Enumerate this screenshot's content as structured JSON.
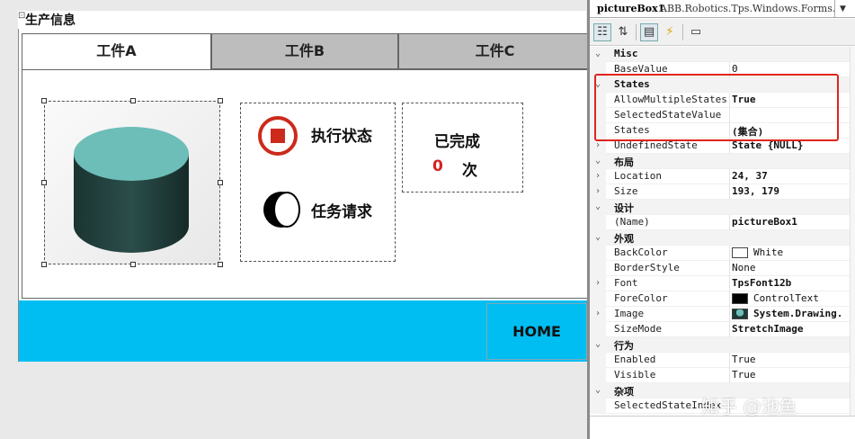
{
  "form": {
    "title_glyph": "⊡",
    "title": "生产信息",
    "tabs": [
      {
        "label": "工件A",
        "active": true
      },
      {
        "label": "工件B",
        "active": false
      },
      {
        "label": "工件C",
        "active": false
      }
    ],
    "status_label": "执行状态",
    "request_label": "任务请求",
    "done_title": "已完成",
    "done_count": "0",
    "done_unit": "次",
    "home_label": "HOME"
  },
  "colors": {
    "bottom_bar": "#00bef2",
    "status_red": "#cc2a1a",
    "cylinder_top": "#6dbdb8",
    "cylinder_side": "#1d3a38",
    "highlight": "#e0241c"
  },
  "properties": {
    "object_name": "pictureBox1",
    "object_type": "ABB.Robotics.Tps.Windows.Forms.Pi",
    "dropdown_icon": "▼",
    "toolbar_icons": [
      "categorized-icon",
      "alphabetical-icon",
      "properties-icon",
      "events-icon",
      "property-pages-icon"
    ],
    "rows": [
      {
        "kind": "cat",
        "glyph": "⌄",
        "name": "Misc"
      },
      {
        "kind": "prop",
        "glyph": "",
        "name": "BaseValue",
        "value": "0",
        "bold": false
      },
      {
        "kind": "cat",
        "glyph": "⌄",
        "name": "States"
      },
      {
        "kind": "prop",
        "glyph": "",
        "name": "AllowMultipleStates",
        "value": "True",
        "bold": true
      },
      {
        "kind": "prop",
        "glyph": "",
        "name": "SelectedStateValue",
        "value": "",
        "bold": false
      },
      {
        "kind": "prop",
        "glyph": "",
        "name": "States",
        "value": "(集合)",
        "bold": true
      },
      {
        "kind": "prop",
        "glyph": "›",
        "name": "UndefinedState",
        "value": "State {NULL}",
        "bold": true
      },
      {
        "kind": "cat",
        "glyph": "⌄",
        "name": "布局"
      },
      {
        "kind": "prop",
        "glyph": "›",
        "name": "Location",
        "value": "24, 37",
        "bold": true
      },
      {
        "kind": "prop",
        "glyph": "›",
        "name": "Size",
        "value": "193, 179",
        "bold": true
      },
      {
        "kind": "cat",
        "glyph": "⌄",
        "name": "设计"
      },
      {
        "kind": "prop",
        "glyph": "",
        "name": "(Name)",
        "value": "pictureBox1",
        "bold": true
      },
      {
        "kind": "cat",
        "glyph": "⌄",
        "name": "外观"
      },
      {
        "kind": "prop",
        "glyph": "",
        "name": "BackColor",
        "value": "White",
        "bold": false,
        "swatch": "#ffffff"
      },
      {
        "kind": "prop",
        "glyph": "",
        "name": "BorderStyle",
        "value": "None",
        "bold": false
      },
      {
        "kind": "prop",
        "glyph": "›",
        "name": "Font",
        "value": "TpsFont12b",
        "bold": true
      },
      {
        "kind": "prop",
        "glyph": "",
        "name": "ForeColor",
        "value": "ControlText",
        "bold": false,
        "swatch": "#000000"
      },
      {
        "kind": "prop",
        "glyph": "›",
        "name": "Image",
        "value": "System.Drawing.",
        "bold": true,
        "swatch": "image"
      },
      {
        "kind": "prop",
        "glyph": "",
        "name": "SizeMode",
        "value": "StretchImage",
        "bold": true
      },
      {
        "kind": "cat",
        "glyph": "⌄",
        "name": "行为"
      },
      {
        "kind": "prop",
        "glyph": "",
        "name": "Enabled",
        "value": "True",
        "bold": false
      },
      {
        "kind": "prop",
        "glyph": "",
        "name": "Visible",
        "value": "True",
        "bold": false
      },
      {
        "kind": "cat",
        "glyph": "⌄",
        "name": "杂项"
      },
      {
        "kind": "prop",
        "glyph": "",
        "name": "SelectedStateIndex",
        "value": "",
        "bold": false
      }
    ]
  },
  "watermark": "知乎 @池鱼"
}
